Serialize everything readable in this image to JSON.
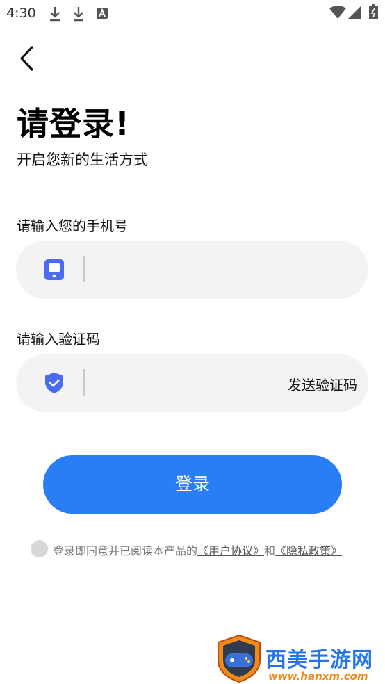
{
  "status_bar": {
    "time": "4:30"
  },
  "header": {
    "title": "请登录!",
    "subtitle": "开启您新的生活方式"
  },
  "phone": {
    "label": "请输入您的手机号",
    "value": "",
    "placeholder": ""
  },
  "code": {
    "label": "请输入验证码",
    "value": "",
    "placeholder": "",
    "send_label": "发送验证码"
  },
  "login_button": {
    "label": "登录"
  },
  "agreement": {
    "checked": false,
    "text": "登录即同意并已阅读本产品的",
    "user_agreement": "《用户协议》",
    "and": "和",
    "privacy_policy": "《隐私政策》"
  },
  "watermark": {
    "title": "西美手游网",
    "url": "www.hanxm.com"
  },
  "colors": {
    "primary": "#2a7ef5",
    "input_bg": "#f3f3f3",
    "icon_blue": "#4a6cf0"
  }
}
